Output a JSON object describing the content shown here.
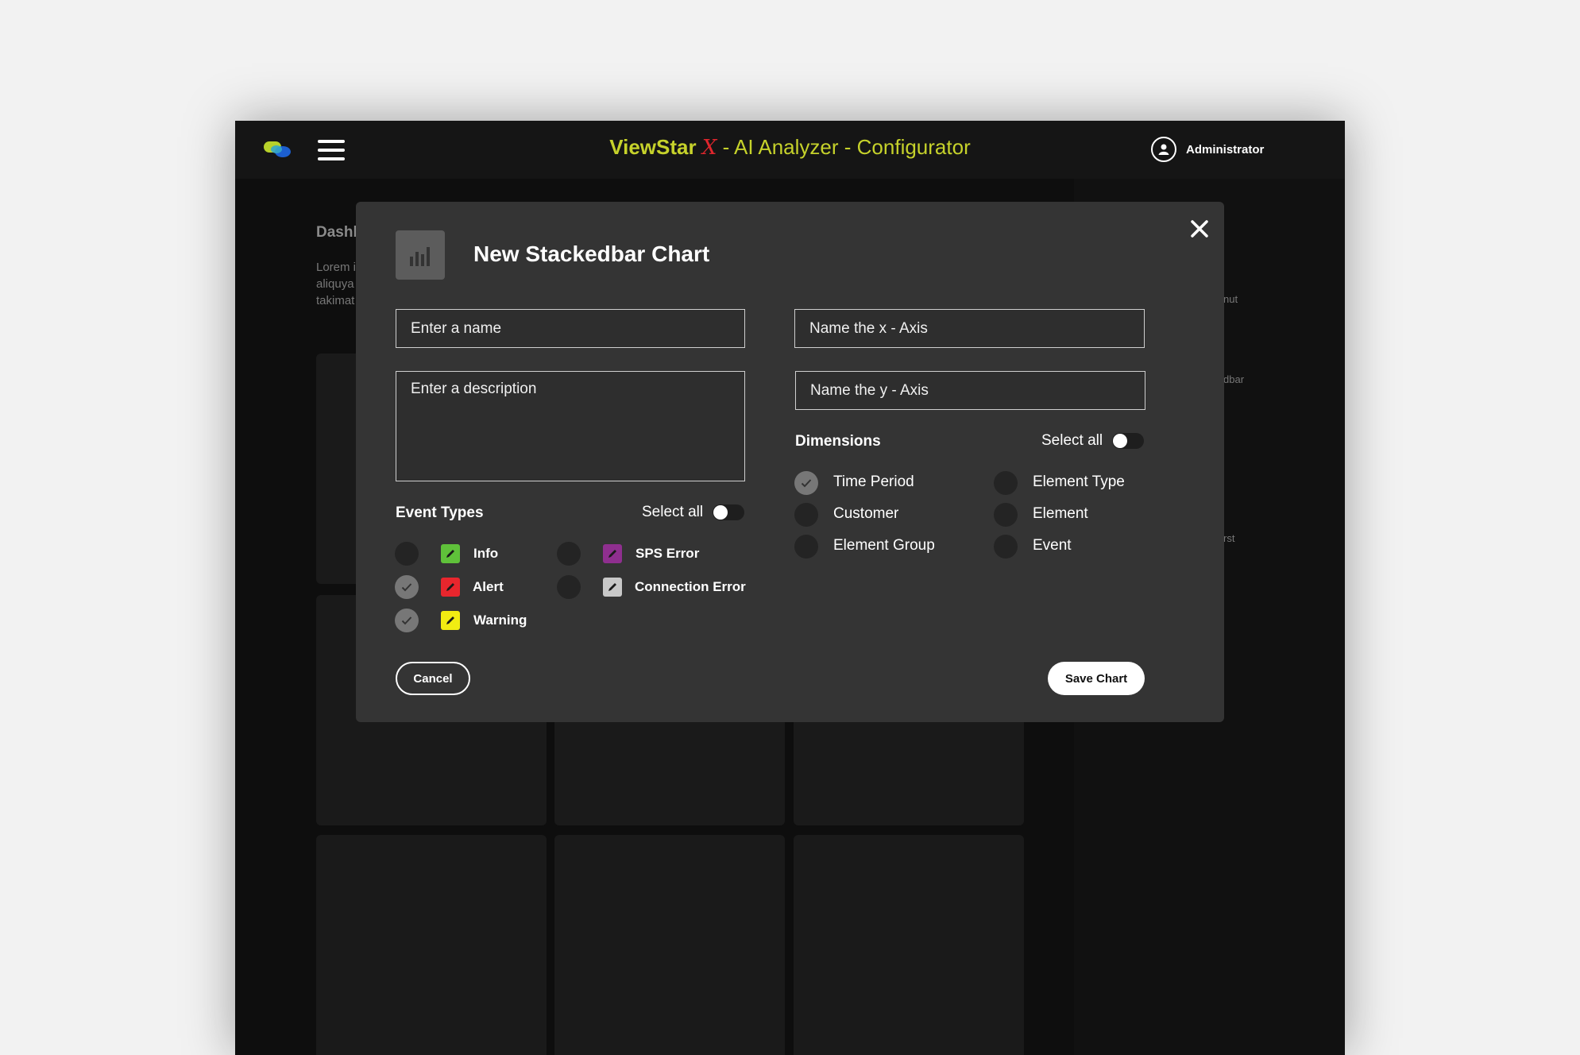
{
  "header": {
    "brand": "ViewStar",
    "brand_x": "X",
    "subtitle": " - AI Analyzer - Configurator",
    "user": "Administrator"
  },
  "background": {
    "title": "Dashb",
    "text_lines": [
      "Lorem i",
      "aliquya",
      "takimat"
    ],
    "side_labels": [
      "nut",
      "dbar",
      "rst"
    ]
  },
  "modal": {
    "title": "New Stackedbar Chart",
    "name_placeholder": "Enter a name",
    "description_placeholder": "Enter a description",
    "x_axis_placeholder": "Name the x - Axis",
    "y_axis_placeholder": "Name the y - Axis",
    "event_types": {
      "label": "Event Types",
      "select_all": "Select all",
      "items": [
        {
          "label": "Info",
          "checked": false,
          "color": "#5fc13a"
        },
        {
          "label": "Alert",
          "checked": true,
          "color": "#e8262d"
        },
        {
          "label": "Warning",
          "checked": true,
          "color": "#f1ec12"
        },
        {
          "label": "SPS Error",
          "checked": false,
          "color": "#8f2f8f"
        },
        {
          "label": "Connection Error",
          "checked": false,
          "color": "#c8c8c8"
        }
      ]
    },
    "dimensions": {
      "label": "Dimensions",
      "select_all": "Select all",
      "items": [
        {
          "label": "Time Period",
          "checked": true
        },
        {
          "label": "Customer",
          "checked": false
        },
        {
          "label": "Element Group",
          "checked": false
        },
        {
          "label": "Element Type",
          "checked": false
        },
        {
          "label": "Element",
          "checked": false
        },
        {
          "label": "Event",
          "checked": false
        }
      ]
    },
    "cancel_label": "Cancel",
    "save_label": "Save Chart"
  }
}
